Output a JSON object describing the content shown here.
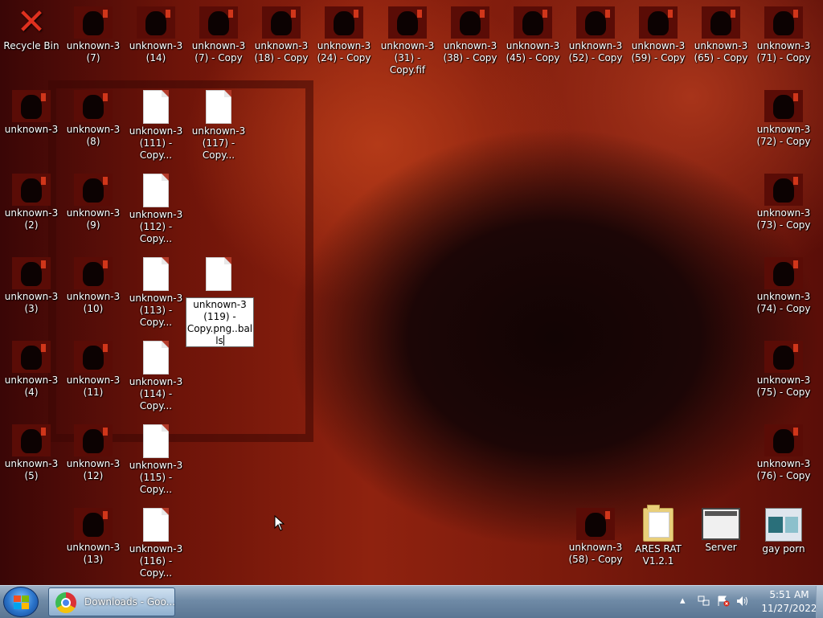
{
  "desktop": {
    "recycle_bin": "Recycle Bin",
    "icons": [
      {
        "l1": "unknown-3",
        "l2": "(7)"
      },
      {
        "l1": "unknown-3",
        "l2": "(14)"
      },
      {
        "l1": "unknown-3",
        "l2": "(7) - Copy"
      },
      {
        "l1": "unknown-3",
        "l2": "(18) - Copy"
      },
      {
        "l1": "unknown-3",
        "l2": "(24) - Copy"
      },
      {
        "l1": "unknown-3",
        "l2": "(31) - Copy.fif"
      },
      {
        "l1": "unknown-3",
        "l2": "(38) - Copy"
      },
      {
        "l1": "unknown-3",
        "l2": "(45) - Copy"
      },
      {
        "l1": "unknown-3",
        "l2": "(52) - Copy"
      },
      {
        "l1": "unknown-3",
        "l2": "(59) - Copy"
      },
      {
        "l1": "unknown-3",
        "l2": "(65) - Copy"
      },
      {
        "l1": "unknown-3",
        "l2": "(71) - Copy"
      },
      {
        "l1": "unknown-3",
        "l2": ""
      },
      {
        "l1": "unknown-3",
        "l2": "(8)"
      },
      {
        "l1": "unknown-3",
        "l2": "(111) - Copy..."
      },
      {
        "l1": "unknown-3",
        "l2": "(117) - Copy..."
      },
      {
        "l1": "unknown-3",
        "l2": "(72) - Copy"
      },
      {
        "l1": "unknown-3",
        "l2": "(2)"
      },
      {
        "l1": "unknown-3",
        "l2": "(9)"
      },
      {
        "l1": "unknown-3",
        "l2": "(112) - Copy..."
      },
      {
        "l1": "unknown-3",
        "l2": "(73) - Copy"
      },
      {
        "l1": "unknown-3",
        "l2": "(3)"
      },
      {
        "l1": "unknown-3",
        "l2": "(10)"
      },
      {
        "l1": "unknown-3",
        "l2": "(113) - Copy..."
      },
      {
        "l1": "unknown-3",
        "l2": "(74) - Copy"
      },
      {
        "l1": "unknown-3",
        "l2": "(4)"
      },
      {
        "l1": "unknown-3",
        "l2": "(11)"
      },
      {
        "l1": "unknown-3",
        "l2": "(114) - Copy..."
      },
      {
        "l1": "unknown-3",
        "l2": "(75) - Copy"
      },
      {
        "l1": "unknown-3",
        "l2": "(5)"
      },
      {
        "l1": "unknown-3",
        "l2": "(12)"
      },
      {
        "l1": "unknown-3",
        "l2": "(115) - Copy..."
      },
      {
        "l1": "unknown-3",
        "l2": "(76) - Copy"
      },
      {
        "l1": "unknown-3",
        "l2": "(13)"
      },
      {
        "l1": "unknown-3",
        "l2": "(116) - Copy..."
      },
      {
        "l1": "unknown-3",
        "l2": "(58) - Copy"
      },
      {
        "l1": "ARES RAT",
        "l2": "V1.2.1"
      },
      {
        "l1": "Server",
        "l2": ""
      },
      {
        "l1": "gay porn",
        "l2": ""
      }
    ],
    "rename": {
      "l1": "unknown-3",
      "l2": "(119) -",
      "l3": "Copy.png..bal",
      "l4": "ls"
    }
  },
  "taskbar": {
    "task_label": "Downloads - Goo...",
    "time": "5:51 AM",
    "date": "11/27/2022",
    "tray_icons": [
      "chevron-up-icon",
      "network-icon",
      "action-center-icon",
      "volume-icon"
    ]
  },
  "colors": {
    "wallpaper": "#6e1409",
    "taskbar": "#6f8aa6",
    "text": "#ffffff"
  }
}
